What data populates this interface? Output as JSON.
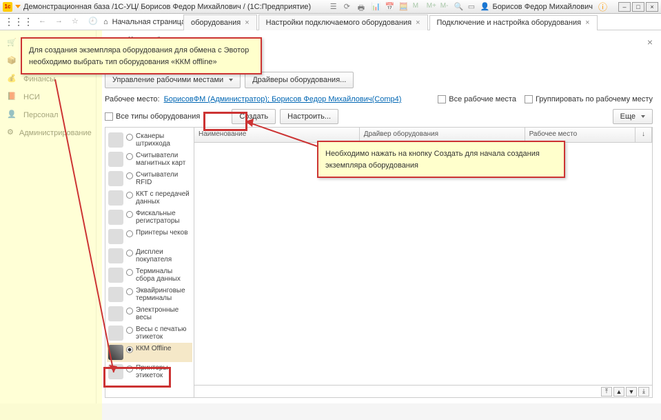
{
  "titlebar": {
    "title": "Демонстрационная база /1С-УЦ/ Борисов Федор Михайлович / (1С:Предприятие)",
    "user": "Борисов Федор Михайлович",
    "info_icon": "ⓘ"
  },
  "toolbar": {
    "home_tab": "Начальная страница"
  },
  "tabs": [
    {
      "label": "оборудования",
      "closable": true
    },
    {
      "label": "Настройки подключаемого оборудования",
      "closable": true
    },
    {
      "label": "Подключение и настройка оборудования",
      "closable": true,
      "active": true
    }
  ],
  "sidebar": [
    {
      "icon": "cart",
      "label": "Продажи"
    },
    {
      "icon": "box",
      "label": "Склад"
    },
    {
      "icon": "coin",
      "label": "Финансы"
    },
    {
      "icon": "book",
      "label": "НСИ"
    },
    {
      "icon": "person",
      "label": "Персонал"
    },
    {
      "icon": "gear",
      "label": "Администрирование"
    }
  ],
  "page": {
    "title": "стройка оборудования",
    "hint": "е оборудование",
    "btn_workplaces": "Управление рабочими местами",
    "btn_drivers": "Драйверы оборудования...",
    "wp_label": "Рабочее место:",
    "wp_link": "БорисовФМ (Администратор); Борисов Федор Михайлович(Comp4)",
    "all_wp": "Все рабочие места",
    "group_wp": "Группировать по рабочему месту",
    "all_types": "Все типы оборудования",
    "btn_create": "Создать",
    "btn_setup": "Настроить...",
    "btn_more": "Еще"
  },
  "types": [
    {
      "label": "Сканеры штрихкода"
    },
    {
      "label": "Считыватели магнитных карт"
    },
    {
      "label": "Считыватели RFID"
    },
    {
      "label": "ККТ с передачей данных"
    },
    {
      "label": "Фискальные регистраторы"
    },
    {
      "label": "Принтеры чеков"
    },
    {
      "label": "Дисплеи покупателя"
    },
    {
      "label": "Терминалы сбора данных"
    },
    {
      "label": "Эквайринговые терминалы"
    },
    {
      "label": "Электронные весы"
    },
    {
      "label": "Весы с печатью этикеток"
    },
    {
      "label": "ККМ Offline",
      "sel": true
    },
    {
      "label": "Принтеры этикеток"
    }
  ],
  "grid": {
    "cols": [
      "Наименование",
      "Драйвер оборудования",
      "Рабочее место",
      "↓"
    ]
  },
  "annotations": {
    "a1": "Для создания экземпляра оборудования для обмена с Эвотор необходимо выбрать тип оборудования «ККМ offline»",
    "a2": "Необходимо нажать на кнопку Создать для начала создания экземпляра оборудования"
  }
}
